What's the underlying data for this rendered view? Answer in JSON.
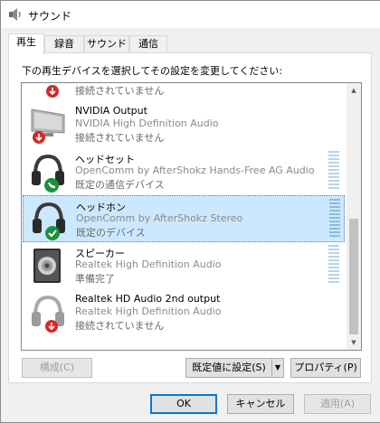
{
  "window": {
    "title": "サウンド"
  },
  "tabs": [
    {
      "label": "再生",
      "active": true
    },
    {
      "label": "録音",
      "active": false
    },
    {
      "label": "サウンド",
      "active": false
    },
    {
      "label": "通信",
      "active": false
    }
  ],
  "instruction": "下の再生デバイスを選択してその設定を変更してください:",
  "devices": [
    {
      "name": "",
      "description": "",
      "status": "接続されていません",
      "icon": "speaker-disconnected-icon",
      "badge": "down-arrow",
      "meter": false,
      "selected": false
    },
    {
      "name": "NVIDIA Output",
      "description": "NVIDIA High Definition Audio",
      "status": "接続されていません",
      "icon": "monitor-icon",
      "badge": "down-arrow",
      "meter": false,
      "selected": false
    },
    {
      "name": "ヘッドセット",
      "description": "OpenComm by AfterShokz Hands-Free AG Audio",
      "status": "既定の通信デバイス",
      "icon": "headset-icon",
      "badge": "phone",
      "meter": true,
      "selected": false
    },
    {
      "name": "ヘッドホン",
      "description": "OpenComm by AfterShokz Stereo",
      "status": "既定のデバイス",
      "icon": "headphones-icon",
      "badge": "check",
      "meter": true,
      "selected": true
    },
    {
      "name": "スピーカー",
      "description": "Realtek High Definition Audio",
      "status": "準備完了",
      "icon": "speaker-icon",
      "badge": "none",
      "meter": true,
      "selected": false
    },
    {
      "name": "Realtek HD Audio 2nd output",
      "description": "Realtek High Definition Audio",
      "status": "接続されていません",
      "icon": "headphones-disconnected-icon",
      "badge": "down-arrow",
      "meter": false,
      "selected": false
    }
  ],
  "buttons": {
    "configure": "構成(C)",
    "set_default": "既定値に設定(S)",
    "properties": "プロパティ(P)",
    "ok": "OK",
    "cancel": "キャンセル",
    "apply": "適用(A)"
  },
  "colors": {
    "selection": "#cce8ff",
    "badge_red": "#d42a2a",
    "badge_green": "#1e8f3e",
    "primary_border": "#0078d7"
  }
}
